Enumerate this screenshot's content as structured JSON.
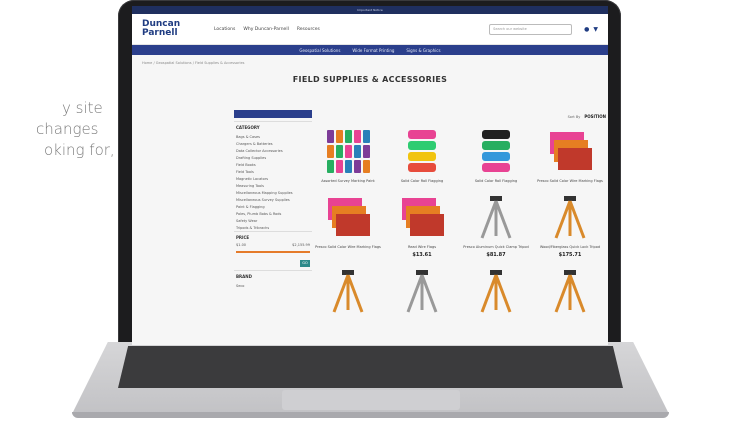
{
  "left_text": [
    "y site",
    "changes",
    "oking for,"
  ],
  "site": {
    "topbar_text": "Important Notice",
    "logo": [
      "Duncan",
      "Parnell"
    ],
    "nav": [
      "Locations",
      "Why Duncan-Parnell",
      "Resources"
    ],
    "search_placeholder": "Search our website",
    "subnav": [
      "Geospatial Solutions",
      "Wide Format Printing",
      "Signs & Graphics"
    ],
    "breadcrumb": "Home / Geospatial Solutions / Field Supplies & Accessories",
    "page_title": "FIELD SUPPLIES & ACCESSORIES",
    "toolbar": {
      "sort_label": "Sort By",
      "sort_value": "POSITION"
    },
    "sidebar": {
      "category_title": "CATEGORY",
      "categories": [
        "Bags & Cases",
        "Chargers & Batteries",
        "Data Collector Accessories",
        "Drafting Supplies",
        "Field Books",
        "Field Tools",
        "Magnetic Locators",
        "Measuring Tools",
        "Miscellaneous Mapping Supplies",
        "Miscellaneous Survey Supplies",
        "Paint & Flagging",
        "Poles, Plumb Bobs & Rods",
        "Safety Wear",
        "Tripods & Tribrachs"
      ],
      "price_title": "PRICE",
      "price_min": "$1.00",
      "price_max": "$2,155.99",
      "go_label": "GO",
      "brand_title": "BRAND",
      "brand_first": "Seco"
    },
    "products": [
      {
        "name": "Assorted Survey Marking Paint",
        "price": "",
        "kind": "paint"
      },
      {
        "name": "Solid Color Roll Flagging",
        "price": "",
        "kind": "tape"
      },
      {
        "name": "Solid Color Roll Flagging",
        "price": "",
        "kind": "tape2"
      },
      {
        "name": "Presco Solid Color Wire Marking Flags",
        "price": "",
        "kind": "flags"
      },
      {
        "name": "Presco Solid Color Wire Marking Flags",
        "price": "",
        "kind": "flags"
      },
      {
        "name": "Read Wire Flags",
        "price": "$13.61",
        "kind": "flags2"
      },
      {
        "name": "Presco Aluminum Quick Clamp Tripod",
        "price": "$81.87",
        "kind": "tripod-gray"
      },
      {
        "name": "Wood/Fiberglass Quick Lock Tripod",
        "price": "$175.71",
        "kind": "tripod-orange"
      },
      {
        "name": "",
        "price": "",
        "kind": "tripod-orange"
      },
      {
        "name": "",
        "price": "",
        "kind": "tripod-gray"
      },
      {
        "name": "",
        "price": "",
        "kind": "tripod-orange"
      },
      {
        "name": "",
        "price": "",
        "kind": "tripod-orange"
      }
    ]
  }
}
